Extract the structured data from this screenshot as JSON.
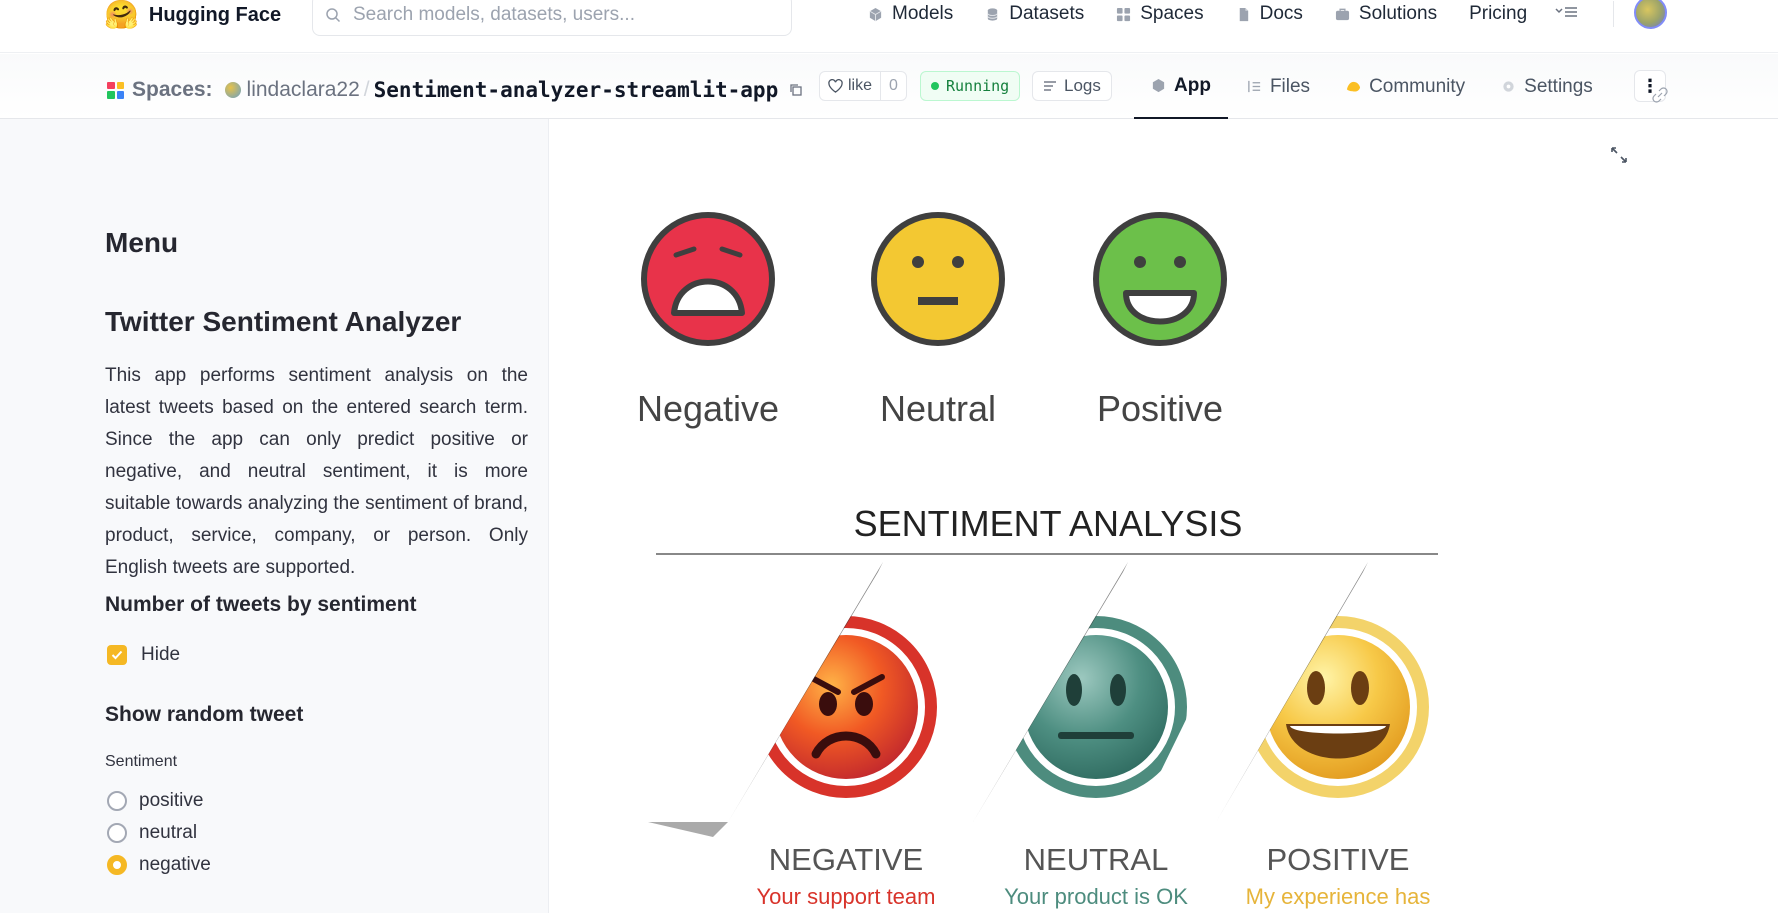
{
  "nav": {
    "brand": "Hugging Face",
    "brand_emoji": "🤗",
    "search_placeholder": "Search models, datasets, users...",
    "links": [
      {
        "label": "Models",
        "icon": "cube-icon"
      },
      {
        "label": "Datasets",
        "icon": "database-icon"
      },
      {
        "label": "Spaces",
        "icon": "grid-icon"
      },
      {
        "label": "Docs",
        "icon": "docs-icon"
      },
      {
        "label": "Solutions",
        "icon": "briefcase-icon"
      }
    ],
    "pricing": "Pricing",
    "more_icon": "chevron-menu-icon"
  },
  "space": {
    "spaces_label": "Spaces:",
    "user": "lindaclara22",
    "separator": "/",
    "repo": "Sentiment-analyzer-streamlit-app",
    "like_label": "like",
    "like_count": "0",
    "status": "Running",
    "logs_label": "Logs",
    "tabs": [
      {
        "label": "App",
        "active": true
      },
      {
        "label": "Files",
        "active": false
      },
      {
        "label": "Community",
        "active": false
      },
      {
        "label": "Settings",
        "active": false
      }
    ],
    "kebab": "⋮"
  },
  "sidebar": {
    "menu_title": "Menu",
    "app_title": "Twitter Sentiment Analyzer",
    "description": "This app performs sentiment analysis on the latest tweets based on the entered search term. Since the app can only predict positive or negative, and neutral sentiment, it is more suitable towards analyzing the sentiment of brand, product, service, company, or person. Only English tweets are supported.",
    "counts_title": "Number of tweets by sentiment",
    "hide_label": "Hide",
    "hide_checked": true,
    "random_title": "Show random tweet",
    "sentiment_label": "Sentiment",
    "options": [
      {
        "label": "positive",
        "selected": false
      },
      {
        "label": "neutral",
        "selected": false
      },
      {
        "label": "negative",
        "selected": true
      }
    ]
  },
  "main": {
    "img1": {
      "labels": [
        "Negative",
        "Neutral",
        "Positive"
      ]
    },
    "img2": {
      "title": "SENTIMENT ANALYSIS",
      "labels": [
        "NEGATIVE",
        "NEUTRAL",
        "POSITIVE"
      ],
      "captions": [
        "Your support team",
        "Your product is OK",
        "My experience has"
      ]
    }
  },
  "colors": {
    "accent": "#f5b824",
    "negative": "#e8334a",
    "neutral": "#f3c832",
    "positive": "#6cc04a",
    "running_green": "#22c55e"
  }
}
